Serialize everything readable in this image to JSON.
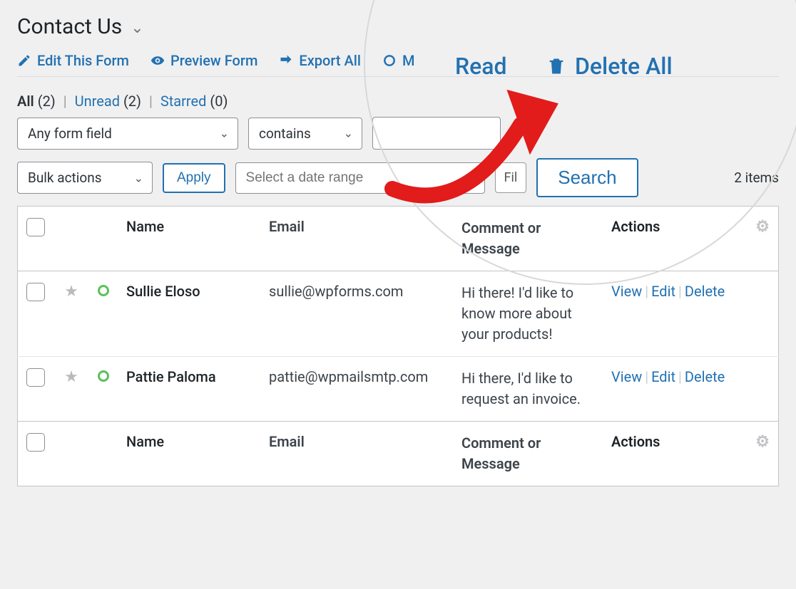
{
  "title": "Contact Us",
  "action_bar": {
    "edit_form": "Edit This Form",
    "preview_form": "Preview Form",
    "export_all": "Export All",
    "mark_read_prefix": "M",
    "read_highlight": "Read",
    "delete_all": "Delete All"
  },
  "filters_status": {
    "all_label": "All",
    "all_count": "(2)",
    "unread_label": "Unread",
    "unread_count": "(2)",
    "starred_label": "Starred",
    "starred_count": "(0)"
  },
  "filter_controls": {
    "field_select": "Any form field",
    "match_select": "contains",
    "bulk_select": "Bulk actions",
    "apply_btn": "Apply",
    "date_placeholder": "Select a date range",
    "filter_btn": "Fil",
    "search_btn": "Search",
    "items_count": "2 items"
  },
  "columns": {
    "name": "Name",
    "email": "Email",
    "message": "Comment or Message",
    "actions": "Actions"
  },
  "rows": [
    {
      "name": "Sullie Eloso",
      "email": "sullie@wpforms.com",
      "message": "Hi there! I'd like to know more about your products!"
    },
    {
      "name": "Pattie Paloma",
      "email": "pattie@wpmailsmtp.com",
      "message": "Hi there, I'd like to request an invoice."
    }
  ],
  "row_actions": {
    "view": "View",
    "edit": "Edit",
    "delete": "Delete"
  }
}
